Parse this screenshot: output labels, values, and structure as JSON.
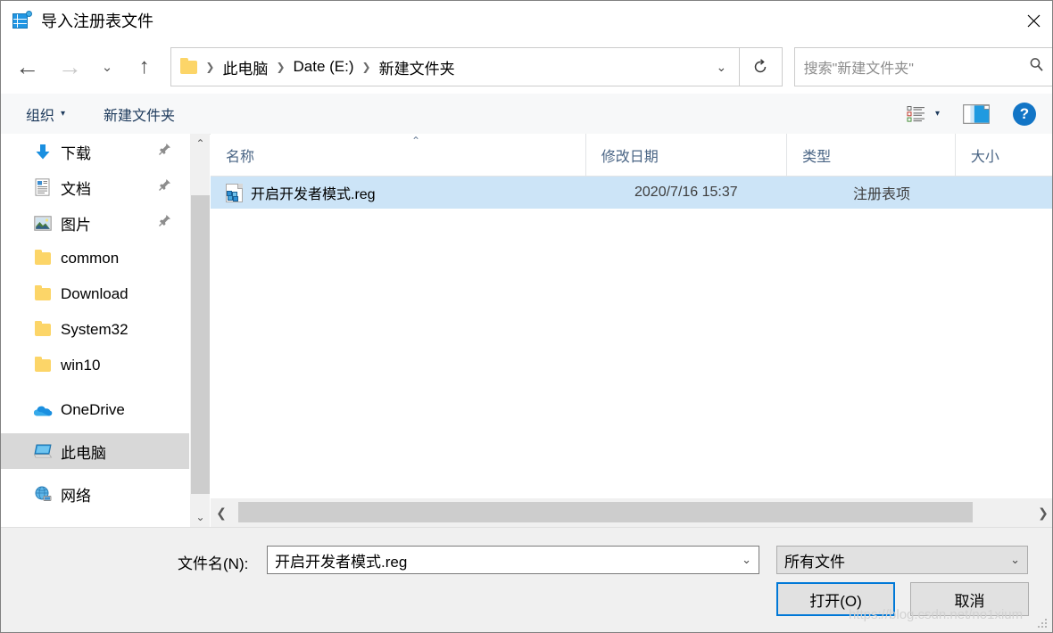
{
  "window": {
    "title": "导入注册表文件",
    "icon": "registry-file-icon",
    "close_label": "✕"
  },
  "nav": {
    "back_icon": "←",
    "forward_icon": "→",
    "recent_icon": "⌄",
    "up_icon": "↑",
    "refresh_icon": "↻",
    "address_chevron": "⌄"
  },
  "breadcrumb": {
    "folder_icon": "folder-icon",
    "separator": "❯",
    "items": [
      {
        "label": "此电脑"
      },
      {
        "label": "Date (E:)"
      },
      {
        "label": "新建文件夹"
      }
    ]
  },
  "search": {
    "placeholder": "搜索\"新建文件夹\"",
    "icon": "search-icon"
  },
  "toolbar": {
    "organize_label": "组织",
    "organize_caret": "▾",
    "new_folder_label": "新建文件夹",
    "view_icon": "view-options-icon",
    "view_caret": "▾",
    "preview_pane_icon": "preview-pane-icon",
    "help_label": "?"
  },
  "sidebar": {
    "scroll_up_icon": "⌃",
    "scroll_down_icon": "⌄",
    "items": [
      {
        "label": "下载",
        "icon": "download-arrow-icon",
        "pinned": true,
        "selected": false
      },
      {
        "label": "文档",
        "icon": "documents-icon",
        "pinned": true,
        "selected": false
      },
      {
        "label": "图片",
        "icon": "pictures-icon",
        "pinned": true,
        "selected": false
      },
      {
        "label": "common",
        "icon": "folder-icon",
        "pinned": false,
        "selected": false
      },
      {
        "label": "Download",
        "icon": "folder-icon",
        "pinned": false,
        "selected": false
      },
      {
        "label": "System32",
        "icon": "folder-icon",
        "pinned": false,
        "selected": false
      },
      {
        "label": "win10",
        "icon": "folder-icon",
        "pinned": false,
        "selected": false
      },
      {
        "label": "OneDrive",
        "icon": "onedrive-cloud-icon",
        "pinned": false,
        "selected": false
      },
      {
        "label": "此电脑",
        "icon": "this-pc-icon",
        "pinned": false,
        "selected": true
      },
      {
        "label": "网络",
        "icon": "network-globe-icon",
        "pinned": false,
        "selected": false
      }
    ]
  },
  "filelist": {
    "columns": [
      {
        "label": "名称"
      },
      {
        "label": "修改日期"
      },
      {
        "label": "类型"
      },
      {
        "label": "大小"
      }
    ],
    "sort_caret": "⌃",
    "rows": [
      {
        "name": "开启开发者模式.reg",
        "date": "2020/7/16 15:37",
        "type": "注册表项",
        "size": "",
        "icon": "reg-file-icon",
        "selected": true
      }
    ]
  },
  "hscrollbar": {
    "left_icon": "❮",
    "right_icon": "❯"
  },
  "footer": {
    "filename_label": "文件名(N):",
    "filename_value": "开启开发者模式.reg",
    "filename_chevron": "⌄",
    "filter_value": "所有文件",
    "filter_chevron": "⌄",
    "open_button": "打开(O)",
    "cancel_button": "取消"
  },
  "watermark": {
    "text": "https://blog.csdn.net/no1xium"
  },
  "colors": {
    "accent": "#0078d7",
    "selection": "#cce4f7",
    "header_text": "#4a6585",
    "command_text": "#1d3a5c",
    "folder_yellow": "#fcd568"
  }
}
